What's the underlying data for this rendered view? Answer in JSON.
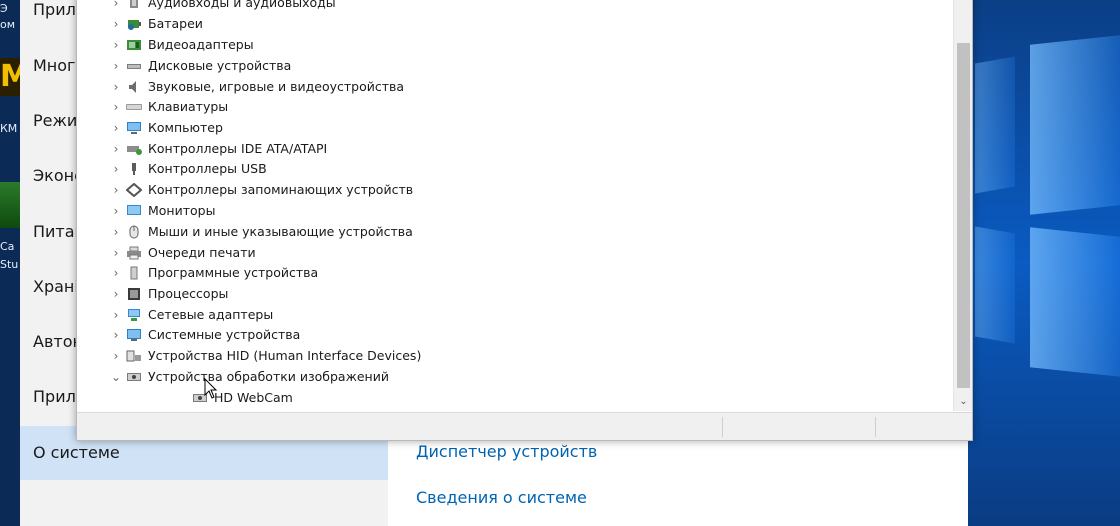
{
  "desktop": {
    "left_text_fragments": [
      "Э",
      "ом",
      "КМ",
      "Ca",
      "Stu"
    ],
    "left_logo_letter": "M"
  },
  "settings": {
    "nav": [
      "Прилс",
      "Многс",
      "Режи",
      "Эконс",
      "Питан",
      "Храні",
      "Автон",
      "Прилс",
      "О системе"
    ],
    "links": [
      "Диспетчер устройств",
      "Сведения о системе"
    ]
  },
  "device_manager": {
    "tree": [
      {
        "label": "Аудиовходы и аудиовыходы",
        "icon": "audio-io-icon",
        "expander": "›"
      },
      {
        "label": "Батареи",
        "icon": "battery-icon",
        "expander": "›"
      },
      {
        "label": "Видеоадаптеры",
        "icon": "display-adapter-icon",
        "expander": "›"
      },
      {
        "label": "Дисковые устройства",
        "icon": "disk-drive-icon",
        "expander": "›"
      },
      {
        "label": "Звуковые, игровые и видеоустройства",
        "icon": "speaker-icon",
        "expander": "›"
      },
      {
        "label": "Клавиатуры",
        "icon": "keyboard-icon",
        "expander": "›"
      },
      {
        "label": "Компьютер",
        "icon": "computer-icon",
        "expander": "›"
      },
      {
        "label": "Контроллеры IDE ATA/ATAPI",
        "icon": "ide-controller-icon",
        "expander": "›"
      },
      {
        "label": "Контроллеры USB",
        "icon": "usb-icon",
        "expander": "›"
      },
      {
        "label": "Контроллеры запоминающих устройств",
        "icon": "storage-controller-icon",
        "expander": "›"
      },
      {
        "label": "Мониторы",
        "icon": "monitor-icon",
        "expander": "›"
      },
      {
        "label": "Мыши и иные указывающие устройства",
        "icon": "mouse-icon",
        "expander": "›"
      },
      {
        "label": "Очереди печати",
        "icon": "printer-icon",
        "expander": "›"
      },
      {
        "label": "Программные устройства",
        "icon": "software-device-icon",
        "expander": "›"
      },
      {
        "label": "Процессоры",
        "icon": "processor-icon",
        "expander": "›"
      },
      {
        "label": "Сетевые адаптеры",
        "icon": "network-adapter-icon",
        "expander": "›"
      },
      {
        "label": "Системные устройства",
        "icon": "system-device-icon",
        "expander": "›"
      },
      {
        "label": "Устройства HID (Human Interface Devices)",
        "icon": "hid-icon",
        "expander": "›"
      },
      {
        "label": "Устройства обработки изображений",
        "icon": "imaging-device-icon",
        "expander": "⌄"
      }
    ],
    "child": {
      "label": "HD WebCam",
      "icon": "webcam-icon"
    }
  },
  "colors": {
    "accent_link": "#0063b1",
    "nav_active_bg": "#cfe2f6",
    "desktop_blue": "#0a5bc2"
  }
}
